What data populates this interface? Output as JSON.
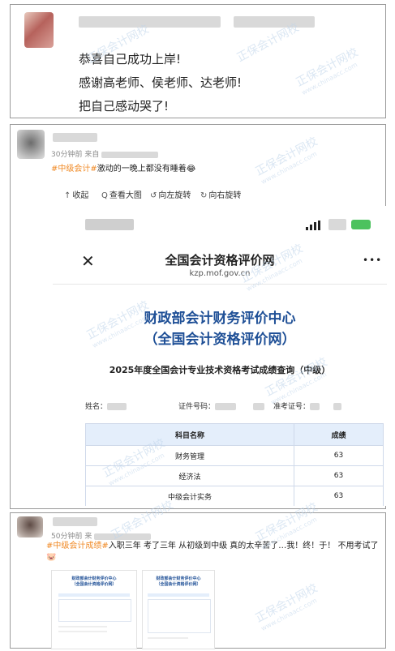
{
  "post1": {
    "lines": [
      "恭喜自己成功上岸!",
      "感谢高老师、侯老师、达老师!",
      "把自己感动哭了!"
    ]
  },
  "post2": {
    "time": "30分钟前",
    "via_prefix": "来自",
    "hashtag": "#中级会计#",
    "text": "激动的一晚上都没有睡着",
    "emoji": "😂",
    "toolbar": {
      "collect": "收起",
      "view_large": "查看大图",
      "rotate_left": "向左旋转",
      "rotate_right": "向右旋转"
    },
    "screenshot": {
      "nav_close": "✕",
      "nav_more": "•••",
      "site_title": "全国会计资格评价网",
      "site_url": "kzp.mof.gov.cn",
      "org_line1": "财政部会计财务评价中心",
      "org_line2": "（全国会计资格评价网）",
      "query_title": "2025年度全国会计专业技术资格考试成绩查询（中级）",
      "field_name": "姓名：",
      "field_id": "证件号码：",
      "field_ticket": "准考证号：",
      "table_headers": [
        "科目名称",
        "成绩"
      ],
      "rows": [
        {
          "subject": "财务管理",
          "score": "63"
        },
        {
          "subject": "经济法",
          "score": "63"
        },
        {
          "subject": "中级会计实务",
          "score": "63"
        }
      ]
    }
  },
  "post3": {
    "time": "50分钟前",
    "via_prefix": "来",
    "hashtag": "#中级会计成绩#",
    "text": "入职三年 考了三年 从初级到中级 真的太辛苦了…我！终！于！ 不用考试了",
    "emoji": "🐷",
    "thumbs": [
      {
        "title1": "财政部会计财务评价中心",
        "title2": "（全国会计资格评价网）"
      },
      {
        "title1": "财政部会计财务评价中心",
        "title2": "（全国会计资格评价网）"
      }
    ]
  },
  "watermark": {
    "brand": "正保会计网校",
    "domain": "www.chinaacc.com"
  },
  "colors": {
    "accent": "#f08a26",
    "link_blue": "#1e4f96",
    "table_head": "#e4eefb"
  }
}
